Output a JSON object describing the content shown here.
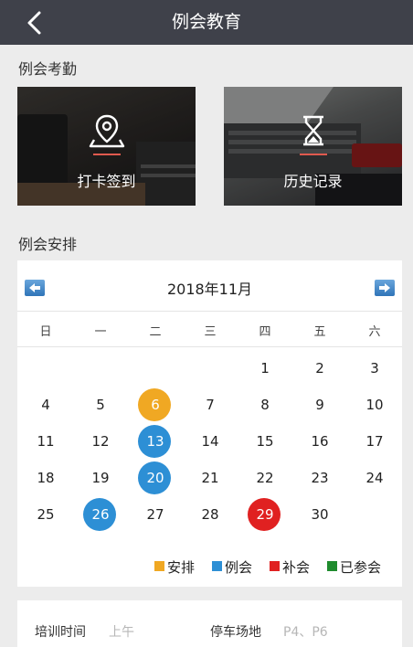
{
  "nav": {
    "title": "例会教育"
  },
  "attendance": {
    "section_title": "例会考勤",
    "cards": [
      {
        "label": "打卡签到",
        "icon": "location-pin-icon"
      },
      {
        "label": "历史记录",
        "icon": "hourglass-icon"
      }
    ]
  },
  "schedule": {
    "section_title": "例会安排"
  },
  "calendar": {
    "title": "2018年11月",
    "weekdays": [
      "日",
      "一",
      "二",
      "三",
      "四",
      "五",
      "六"
    ],
    "weeks": [
      [
        "",
        "",
        "",
        "",
        "1",
        "2",
        "3"
      ],
      [
        "4",
        "5",
        "6",
        "7",
        "8",
        "9",
        "10"
      ],
      [
        "11",
        "12",
        "13",
        "14",
        "15",
        "16",
        "17"
      ],
      [
        "18",
        "19",
        "20",
        "21",
        "22",
        "23",
        "24"
      ],
      [
        "25",
        "26",
        "27",
        "28",
        "29",
        "30",
        ""
      ]
    ],
    "marked_days": {
      "6": "安排",
      "13": "例会",
      "20": "例会",
      "26": "例会",
      "29": "补会"
    },
    "legend": [
      {
        "label": "安排",
        "color": "#f0a823"
      },
      {
        "label": "例会",
        "color": "#2d8fd5"
      },
      {
        "label": "补会",
        "color": "#e02121"
      },
      {
        "label": "已参会",
        "color": "#1f8c2e"
      }
    ]
  },
  "info": {
    "training_time_label": "培训时间",
    "training_time_value": "上午",
    "parking_label": "停车场地",
    "parking_value": "P4、P6"
  }
}
